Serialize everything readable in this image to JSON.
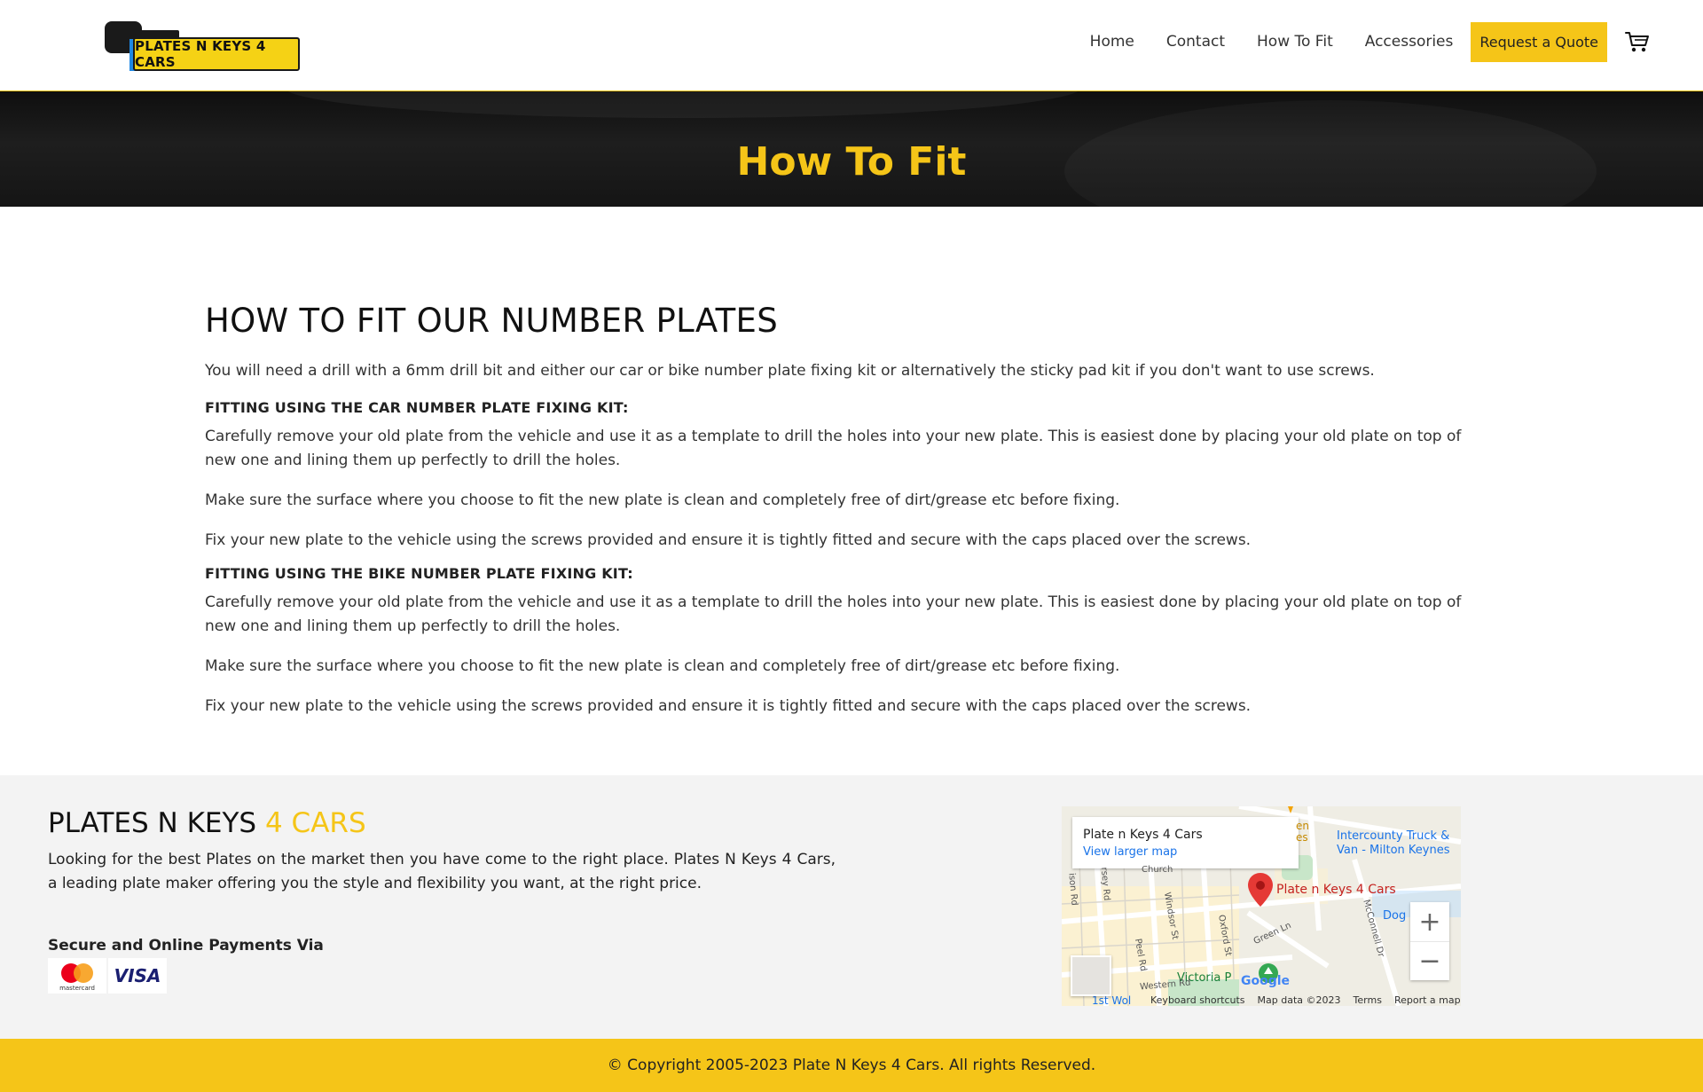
{
  "header": {
    "logo_text": "PLATES N KEYS 4 CARS",
    "nav": [
      "Home",
      "Contact",
      "How To Fit",
      "Accessories"
    ],
    "quote_button": "Request a Quote",
    "cart_icon": "cart-icon"
  },
  "banner": {
    "title": "How To Fit"
  },
  "main": {
    "heading": "HOW TO FIT OUR NUMBER PLATES",
    "intro": "You will need a drill with a 6mm drill bit and either our car or bike number plate fixing kit or alternatively the sticky pad kit if you don't want to use screws.",
    "car": {
      "heading": "FITTING USING THE CAR NUMBER PLATE FIXING KIT:",
      "steps": [
        "Carefully remove your old plate from the vehicle and use it as a template to drill the holes into your new plate. This is easiest done by placing your old plate on top of new one and lining them up perfectly to drill the holes.",
        "Make sure the surface where you choose to fit the new plate is clean and completely free of dirt/grease etc before fixing.",
        "Fix your new plate to the vehicle using the screws provided and ensure it is tightly fitted and secure with the caps placed over the screws."
      ]
    },
    "bike": {
      "heading": "FITTING USING THE BIKE NUMBER PLATE FIXING KIT:",
      "steps": [
        "Carefully remove your old plate from the vehicle and use it as a template to drill the holes into your new plate. This is easiest done by placing your old plate on top of new one and lining them up perfectly to drill the holes.",
        "Make sure the surface where you choose to fit the new plate is clean and completely free of dirt/grease etc before fixing.",
        "Fix your new plate to the vehicle using the screws provided and ensure it is tightly fitted and secure with the caps placed over the screws."
      ]
    }
  },
  "footer": {
    "brand_main": "PLATES N KEYS ",
    "brand_accent": "4 CARS",
    "description": "Looking for the best Plates on the market then you have come to the right place. Plates N Keys 4 Cars, a leading plate maker offering you the style and flexibility you want, at the right price.",
    "payments_title": "Secure and Online Payments Via",
    "mastercard_label": "mastercard",
    "visa_label": "VISA",
    "map": {
      "place_name": "Plate n Keys 4 Cars",
      "larger_map": "View larger map",
      "pin_label": "Plate n Keys 4 Cars",
      "poi_truck": "Intercounty Truck &\nVan - Milton Keynes",
      "poi_dog": "Dog",
      "poi_park": "Victoria P",
      "poi_top": "en\nes",
      "streets": [
        "Windsor St",
        "Oxford St",
        "Green Ln",
        "Peel Rd",
        "McConnell Dr",
        "rsey Rd",
        "Church",
        "ison Rd",
        "Western Rd",
        "1st Wol"
      ],
      "zoom_in": "+",
      "zoom_out": "−",
      "google": "Google",
      "keyboard": "Keyboard shortcuts",
      "map_data": "Map data ©2023",
      "terms": "Terms",
      "report": "Report a map error"
    }
  },
  "copyright": "© Copyright 2005-2023 Plate N Keys 4 Cars. All rights Reserved.",
  "colors": {
    "accent": "#f5c518",
    "banner_bg": "#1a1a1a",
    "footer_bg": "#f3f3f3"
  }
}
